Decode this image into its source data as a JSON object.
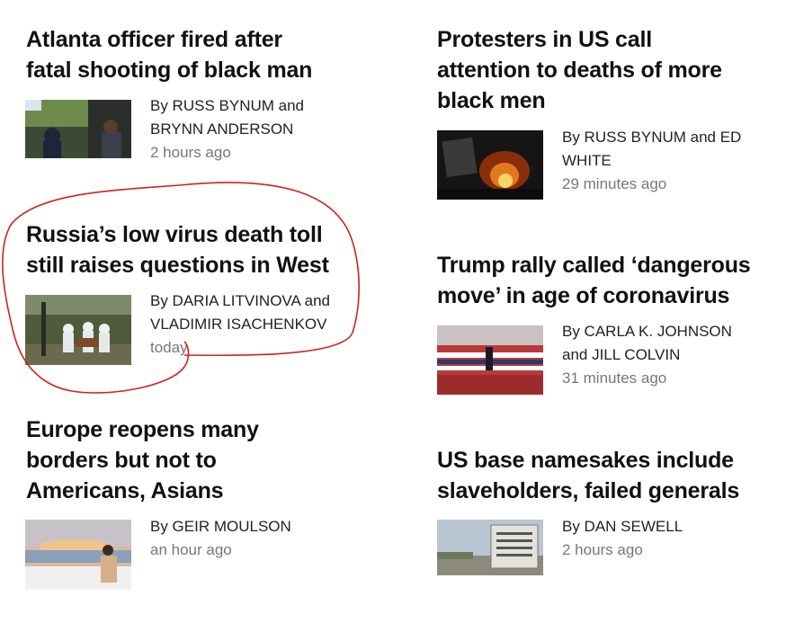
{
  "stories": [
    {
      "headline": "Atlanta officer fired after fatal shooting of black man",
      "byline_line1": "By RUSS BYNUM and",
      "byline_line2": "BRYNN ANDERSON",
      "time": "2 hours ago"
    },
    {
      "headline": "Protesters in US call attention to deaths of more black men",
      "byline_line1": "By RUSS BYNUM and ED",
      "byline_line2": "WHITE",
      "time": "29 minutes ago"
    },
    {
      "headline": "Russia’s low virus death toll still raises questions in West",
      "byline_line1": "By DARIA LITVINOVA and",
      "byline_line2": "VLADIMIR ISACHENKOV",
      "time": "today"
    },
    {
      "headline": "Trump rally called ‘dangerous move’ in age of coronavirus",
      "byline_line1": "By CARLA K. JOHNSON",
      "byline_line2": "and JILL COLVIN",
      "time": "31 minutes ago"
    },
    {
      "headline": "Europe reopens many borders but not to Americans, Asians",
      "byline_line1": "By GEIR MOULSON",
      "byline_line2": "",
      "time": "an hour ago"
    },
    {
      "headline": "US base namesakes include slaveholders, failed generals",
      "byline_line1": "By DAN SEWELL",
      "byline_line2": "",
      "time": "2 hours ago"
    }
  ],
  "annotation_color": "#d42020"
}
